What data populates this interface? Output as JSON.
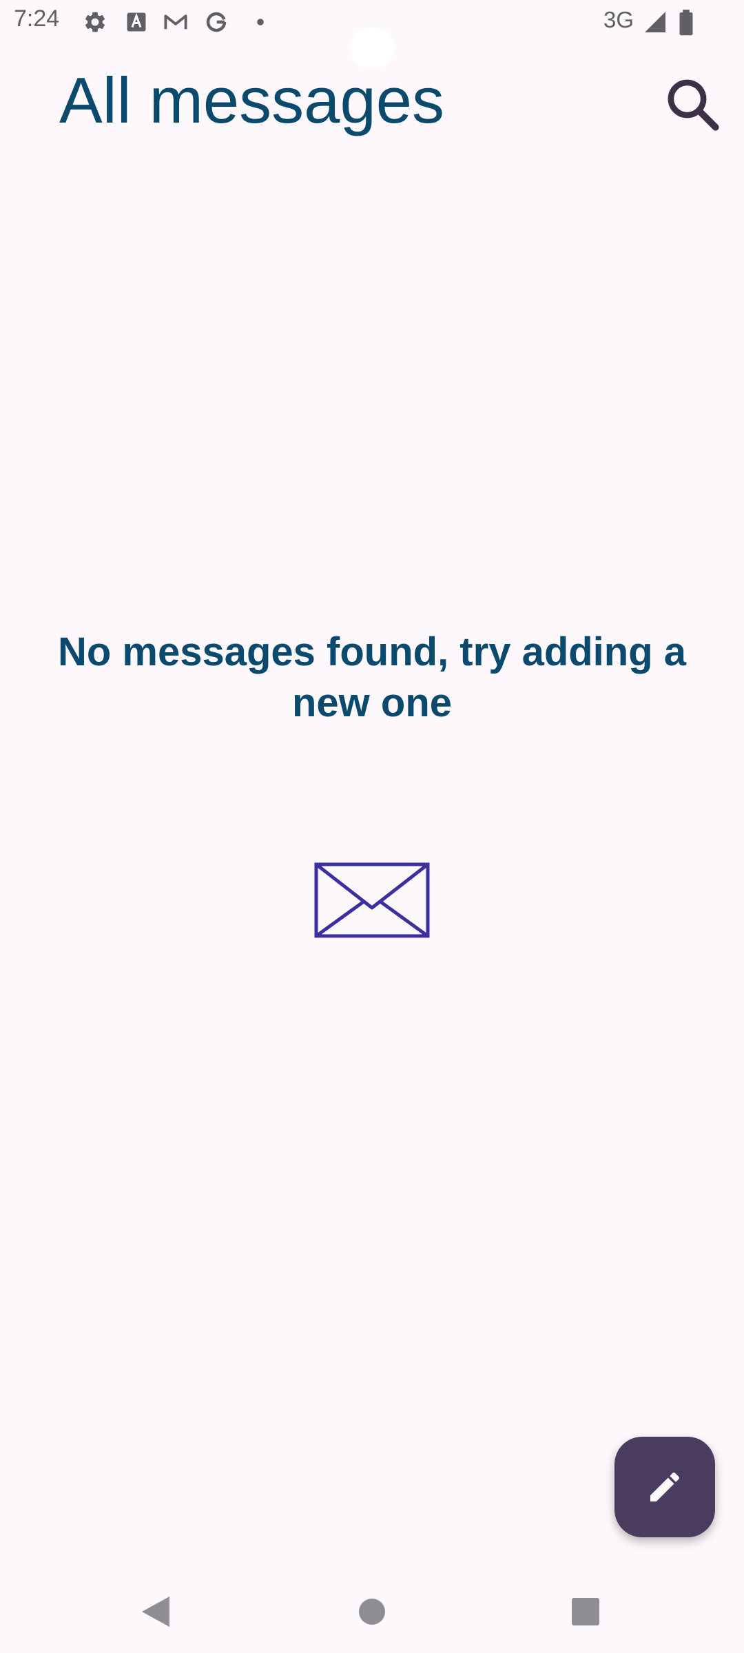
{
  "status_bar": {
    "time": "7:24",
    "network": "3G",
    "notification_icons": [
      "settings-icon",
      "font-a-icon",
      "gmail-icon",
      "google-icon",
      "more-notifications-dot-icon"
    ],
    "system_icons": [
      "signal-icon",
      "battery-icon"
    ]
  },
  "header": {
    "title": "All messages",
    "search_icon": "search-icon"
  },
  "empty_state": {
    "message": "No messages found, try adding a new one",
    "icon": "envelope-icon"
  },
  "fab": {
    "icon": "pencil-icon"
  },
  "navigation": {
    "buttons": [
      "back-icon",
      "home-icon",
      "recents-icon"
    ]
  },
  "colors": {
    "background": "#fdf8fc",
    "title": "#0b4a6d",
    "envelope": "#3c2fa0",
    "fab": "#4a3c5f",
    "search_icon": "#3d3048"
  }
}
